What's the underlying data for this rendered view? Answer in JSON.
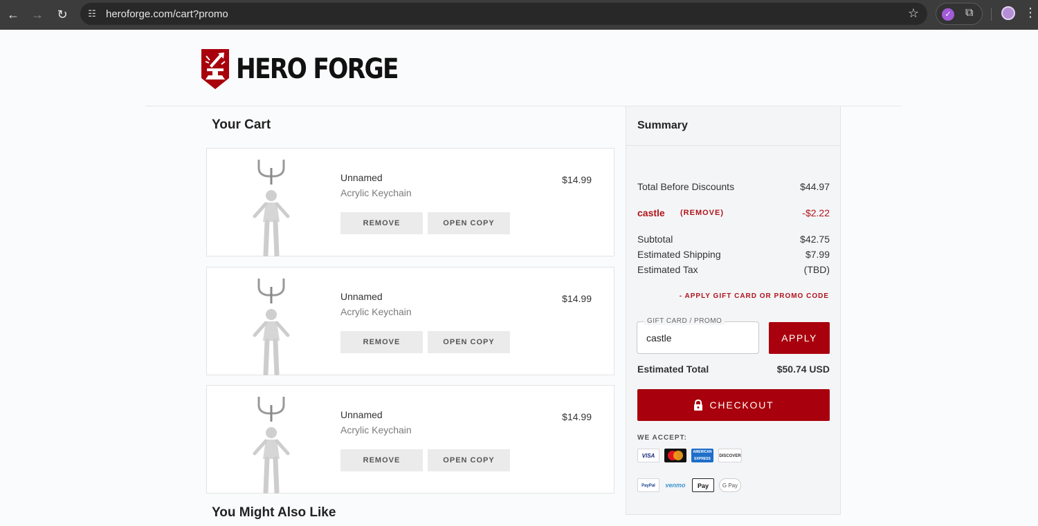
{
  "browser": {
    "url": "heroforge.com/cart?promo",
    "back_icon": "←",
    "forward_icon": "→",
    "reload_icon": "↻",
    "site_icon": "☷",
    "star_icon": "☆",
    "ext_icon": "⧉",
    "menu_icon": "⋮"
  },
  "brand": {
    "name": "HERO FORGE",
    "color": "#a8000c"
  },
  "cart": {
    "title": "Your Cart",
    "items": [
      {
        "name": "Unnamed",
        "type": "Acrylic Keychain",
        "price": "$14.99",
        "remove_label": "REMOVE",
        "open_copy_label": "OPEN COPY"
      },
      {
        "name": "Unnamed",
        "type": "Acrylic Keychain",
        "price": "$14.99",
        "remove_label": "REMOVE",
        "open_copy_label": "OPEN COPY"
      },
      {
        "name": "Unnamed",
        "type": "Acrylic Keychain",
        "price": "$14.99",
        "remove_label": "REMOVE",
        "open_copy_label": "OPEN COPY"
      }
    ]
  },
  "also_like": {
    "title": "You Might Also Like"
  },
  "summary": {
    "title": "Summary",
    "total_before_label": "Total Before Discounts",
    "total_before_value": "$44.97",
    "promo_code": "castle",
    "promo_remove_label": "(REMOVE)",
    "promo_discount": "-$2.22",
    "subtotal_label": "Subtotal",
    "subtotal_value": "$42.75",
    "shipping_label": "Estimated Shipping",
    "shipping_value": "$7.99",
    "tax_label": "Estimated Tax",
    "tax_value": "(TBD)",
    "apply_link": "- APPLY GIFT CARD OR PROMO CODE",
    "field_label": "GIFT CARD / PROMO",
    "field_value": "castle",
    "apply_button": "APPLY",
    "estimated_total_label": "Estimated Total",
    "estimated_total_value": "$50.74 USD",
    "checkout_label": "CHECKOUT",
    "we_accept_label": "WE ACCEPT:",
    "payment_methods": {
      "visa": "VISA",
      "amex": "AMERICAN EXPRESS",
      "discover": "DISCOVER",
      "paypal": "PayPal",
      "venmo": "venmo",
      "apple_pay": "Pay",
      "google_pay": "G Pay"
    }
  }
}
